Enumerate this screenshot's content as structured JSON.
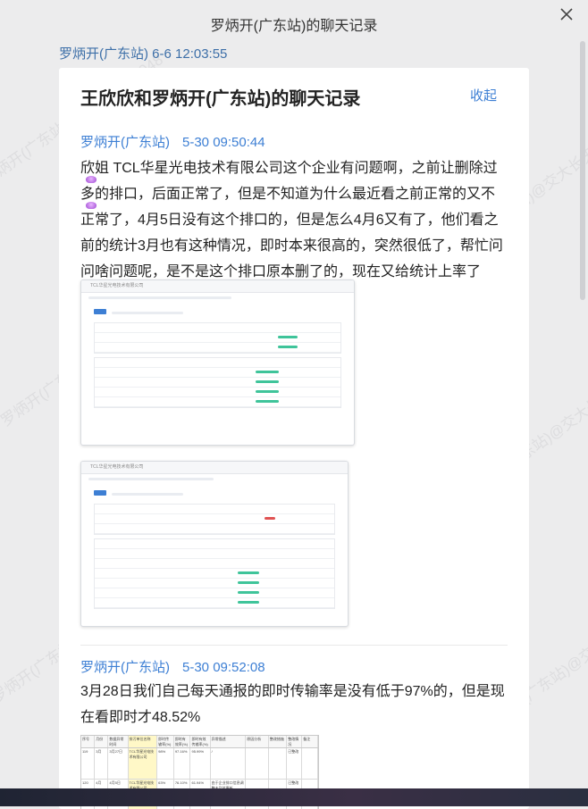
{
  "window": {
    "title": "罗炳开(广东站)的聊天记录"
  },
  "header": {
    "sub_label": "罗炳开(广东站) 6-6 12:03:55"
  },
  "record": {
    "title": "王欣欣和罗炳开(广东站)的聊天记录",
    "collapse_label": "收起",
    "messages": [
      {
        "sender": "罗炳开(广东站)",
        "time": "5-30 09:50:44",
        "text": "欣姐 TCL华星光电技术有限公司这个企业有问题啊，之前让删除过多的排口，后面正常了，但是不知道为什么最近看之前正常的又不正常了，4月5日没有这个排口的，但是怎么4月6又有了，他们看之前的统计3月也有这种情况，即时本来很高的，突然很低了，帮忙问问啥问题呢，是不是这个排口原本删了的，现在又给统计上率了"
      },
      {
        "sender": "罗炳开(广东站)",
        "time": "5-30 09:52:08",
        "text": "3月28日我们自己每天通报的即时传输率是没有低于97%的，但是现在看即时才48.52%"
      }
    ]
  },
  "attachments": {
    "shot1_title": "TCL华星光电技术有限公司",
    "shot2_title": "TCL华星光电技术有限公司",
    "sheet_headers": [
      "序号",
      "月份",
      "数据异常时间",
      "排污单位名称",
      "即时传输率(%)",
      "即时有效率(%)",
      "即时有效传输率(%)",
      "异常描述",
      "原因分析",
      "整改措施",
      "整改情况",
      "备注"
    ],
    "sheet_rows": [
      [
        "119",
        "3月",
        "3月27日",
        "TCL华星光电技术有限公司",
        "98%",
        "97.16%",
        "95.99%",
        "/",
        "",
        "",
        "已整改",
        ""
      ],
      [
        "120",
        "4月",
        "4月5日",
        "TCL华星光电技术有限公司",
        "63%",
        "76.10%",
        "61.94%",
        "由于企业排口信息调整未及时更新",
        "",
        "",
        "已整改",
        ""
      ]
    ]
  },
  "watermark_text": "罗炳开(广东站)@交大长天 6048",
  "icons": {
    "close": "close-icon"
  }
}
